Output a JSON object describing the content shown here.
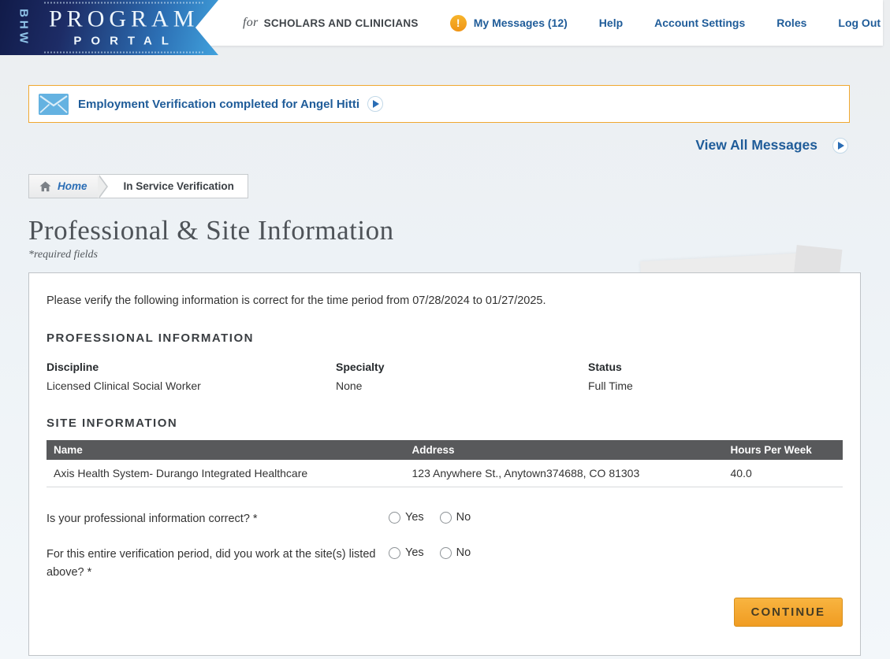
{
  "brand": {
    "vertical": "BHW",
    "line1": "PROGRAM",
    "line2": "PORTAL"
  },
  "header": {
    "audience_prefix": "for",
    "audience": "SCHOLARS AND CLINICIANS",
    "alert_glyph": "!",
    "messages_label": "My Messages (12)",
    "links": [
      "Help",
      "Account Settings",
      "Roles",
      "Log Out"
    ]
  },
  "notification": {
    "text": "Employment Verification completed for Angel Hitti"
  },
  "view_all_label": "View All Messages",
  "breadcrumb": {
    "home": "Home",
    "current": "In Service Verification"
  },
  "page": {
    "title": "Professional & Site Information",
    "required_note": "*required fields"
  },
  "panel": {
    "intro": "Please verify the following information is correct for the time period from 07/28/2024 to 01/27/2025.",
    "professional_section": {
      "heading": "PROFESSIONAL INFORMATION",
      "fields": [
        {
          "label": "Discipline",
          "value": "Licensed Clinical Social Worker"
        },
        {
          "label": "Specialty",
          "value": "None"
        },
        {
          "label": "Status",
          "value": "Full Time"
        }
      ]
    },
    "site_section": {
      "heading": "SITE INFORMATION",
      "table": {
        "columns": [
          "Name",
          "Address",
          "Hours Per Week"
        ],
        "rows": [
          [
            "Axis Health System- Durango Integrated Healthcare",
            "123 Anywhere St., Anytown374688, CO 81303",
            "40.0"
          ]
        ]
      }
    },
    "questions": [
      {
        "text": "Is your professional information correct? *",
        "options": [
          "Yes",
          "No"
        ]
      },
      {
        "text": "For this entire verification period, did you work at the site(s) listed above? *",
        "options": [
          "Yes",
          "No"
        ]
      }
    ],
    "continue_label": "CONTINUE"
  },
  "colors": {
    "nav_blue": "#1f5c99",
    "banner_border_orange": "#f0a830",
    "table_header_gray": "#58595b",
    "button_orange": "#f3a62f",
    "logo_navy": "#1d2c66",
    "logo_light_blue": "#41a2dd"
  }
}
